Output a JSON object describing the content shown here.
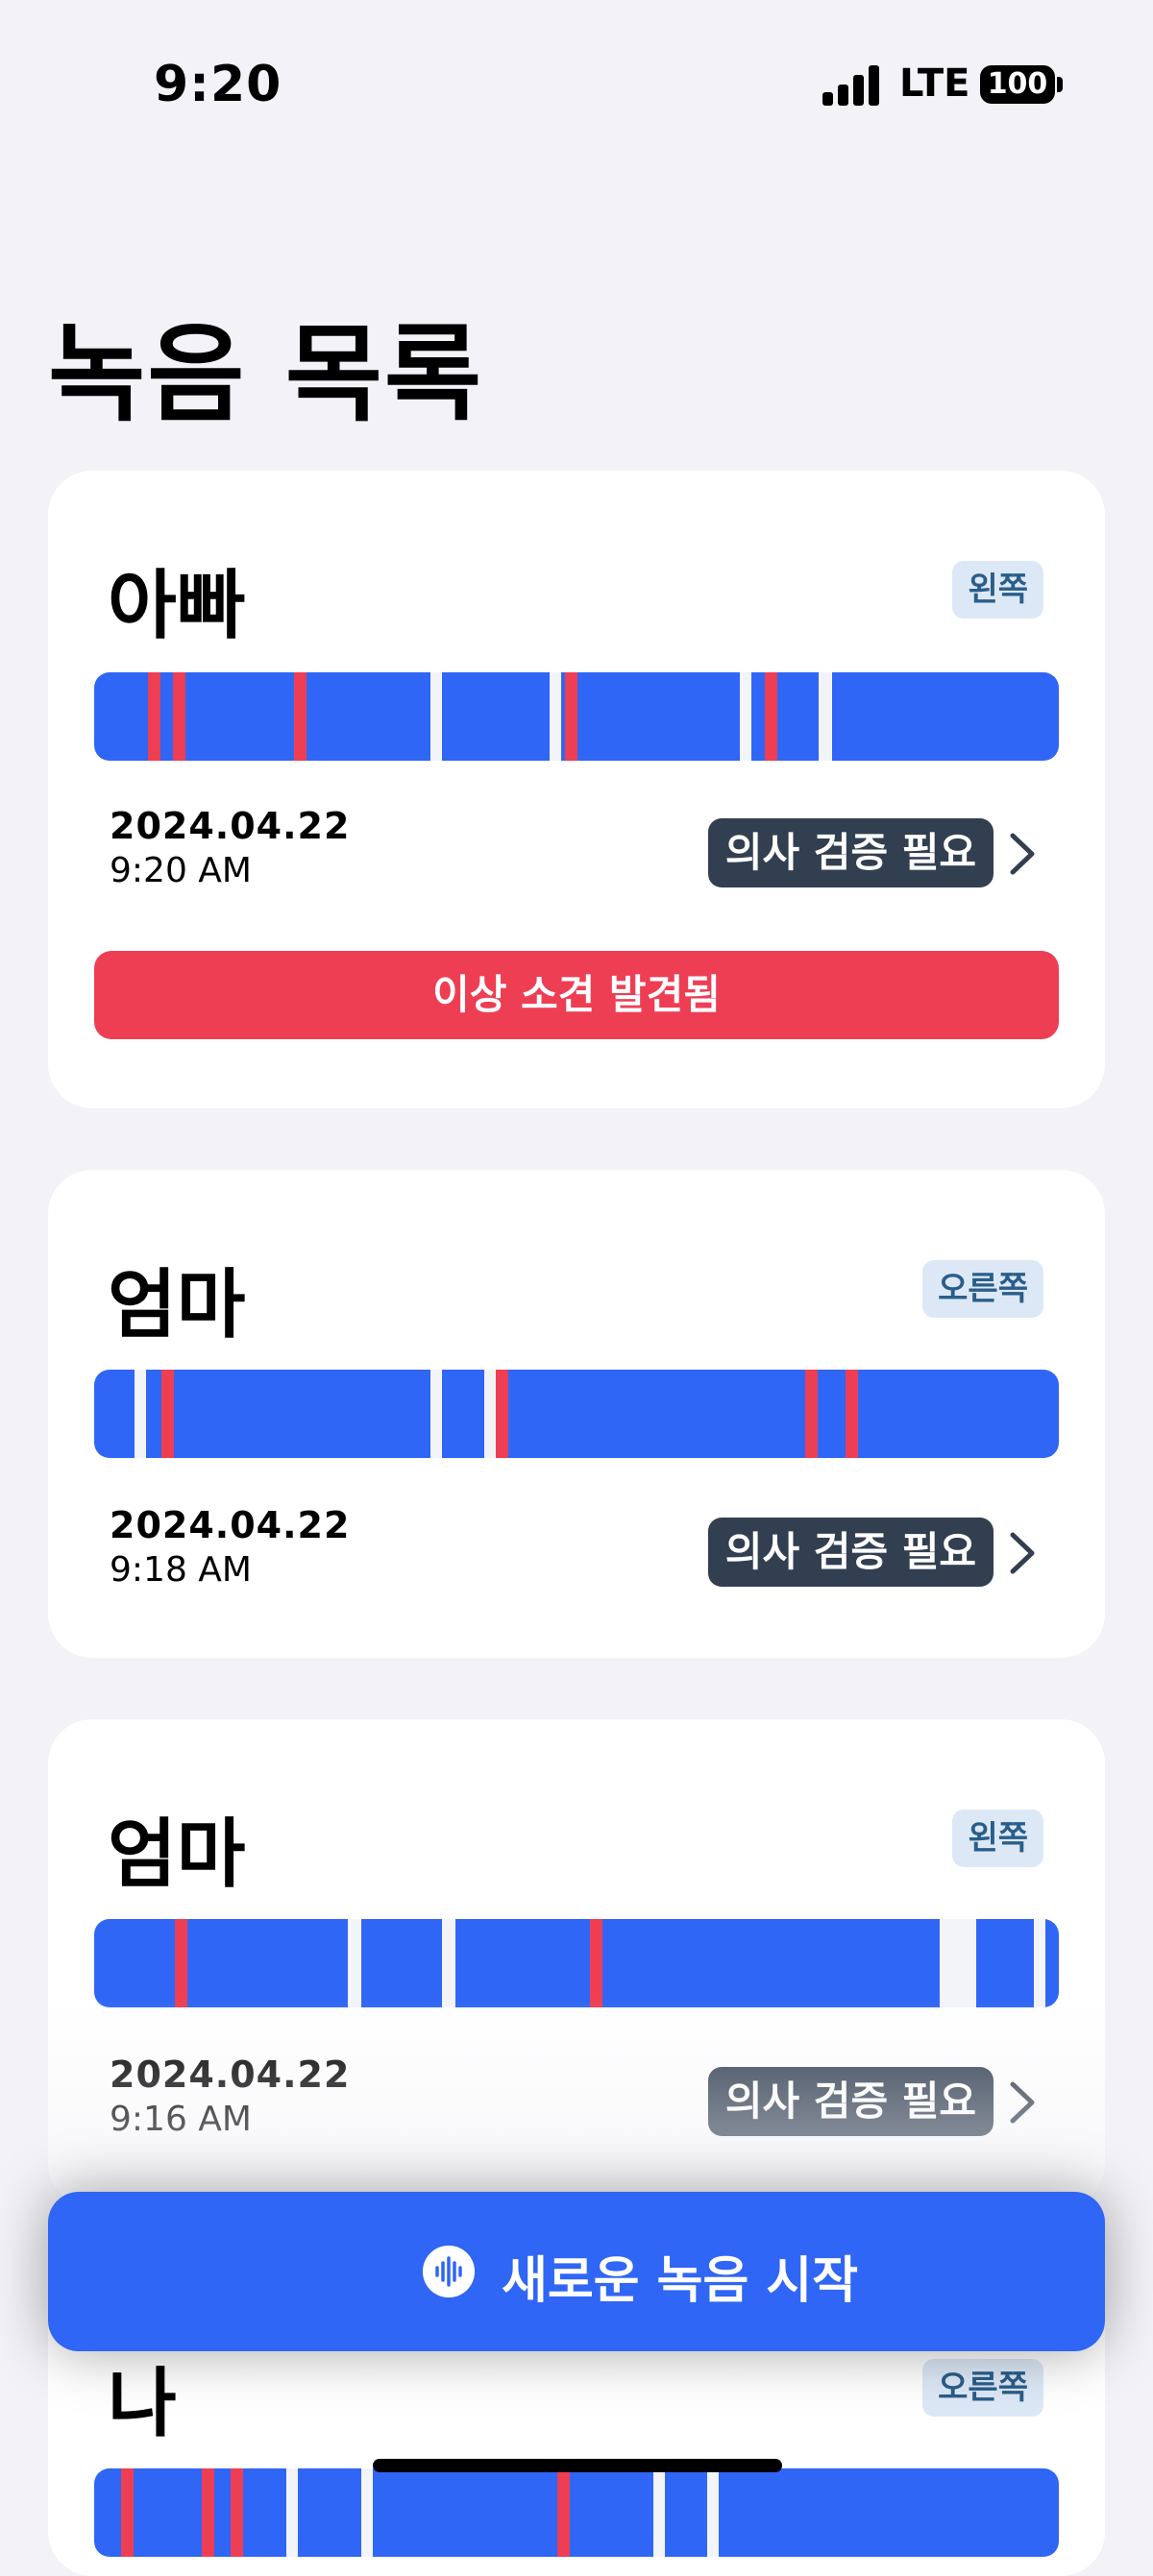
{
  "status": {
    "time": "9:20",
    "network": "LTE",
    "battery": "100"
  },
  "title": "녹음 목록",
  "verify_label": "의사 검증 필요",
  "alert_label": "이상 소견 발견됨",
  "new_recording_label": "새로운 녹음 시작",
  "colors": {
    "accent": "#3066f5",
    "alert": "#ee3e54",
    "badge_dark": "#323f50",
    "side_badge_bg": "#dde8f6"
  },
  "recordings": [
    {
      "name": "아빠",
      "side": "왼쪽",
      "date": "2024.04.22",
      "time": "9:20 AM",
      "has_alert": true
    },
    {
      "name": "엄마",
      "side": "오른쪽",
      "date": "2024.04.22",
      "time": "9:18 AM",
      "has_alert": false
    },
    {
      "name": "엄마",
      "side": "왼쪽",
      "date": "2024.04.22",
      "time": "9:16 AM",
      "has_alert": false
    },
    {
      "name": "나",
      "side": "오른쪽"
    }
  ]
}
